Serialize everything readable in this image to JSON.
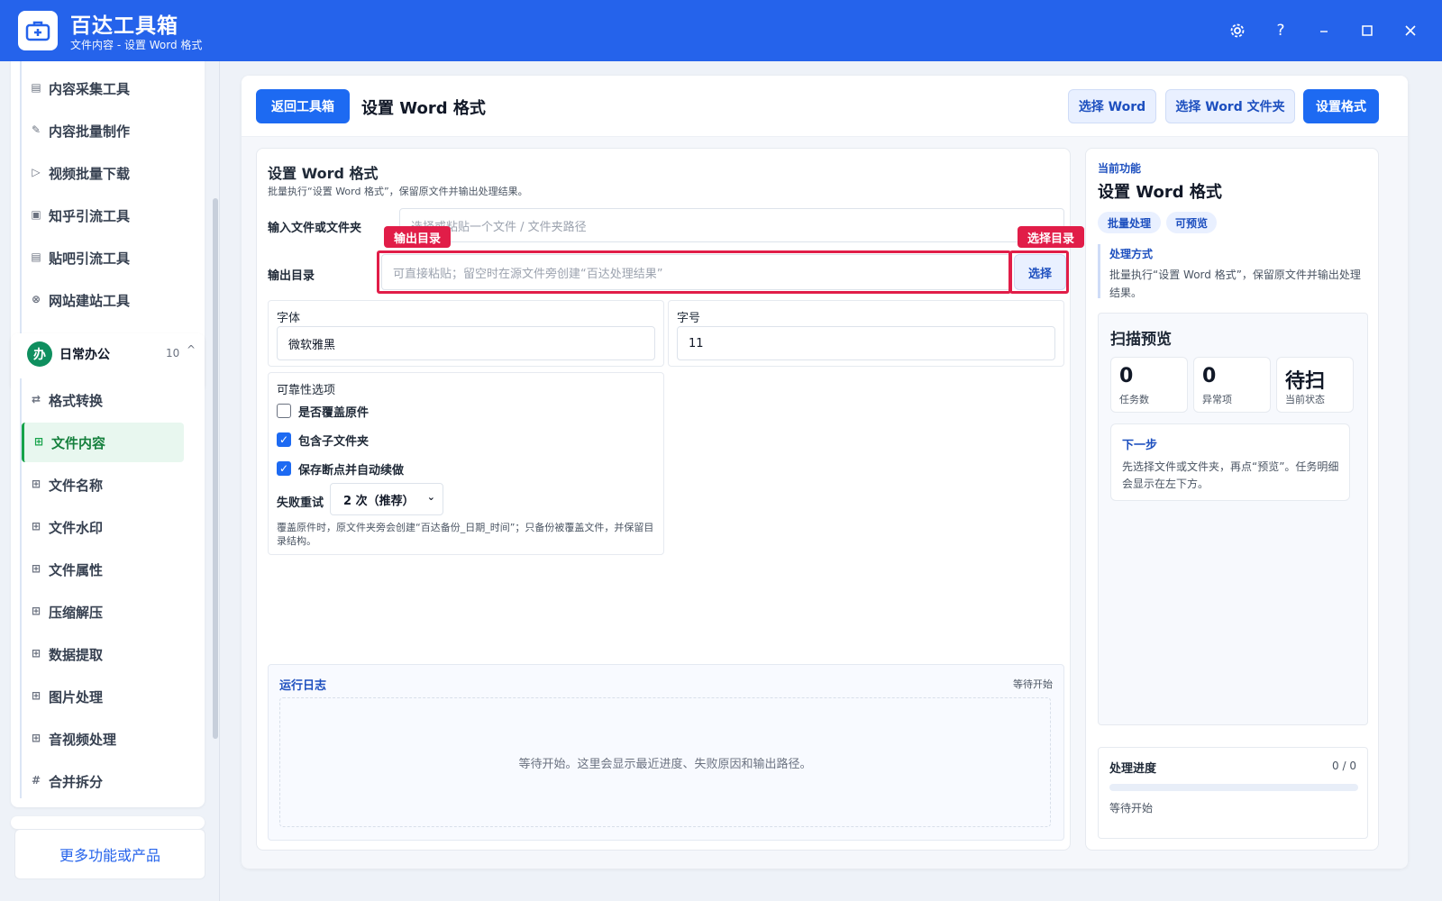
{
  "titlebar": {
    "app_title": "百达工具箱",
    "subtitle": "文件内容 - 设置 Word 格式",
    "icons": [
      "settings-icon",
      "help-icon",
      "minimize-icon",
      "maximize-icon",
      "close-icon"
    ]
  },
  "sidebar": {
    "group1_items": [
      {
        "label": "内容采集工具",
        "icon": "collect-icon"
      },
      {
        "label": "内容批量制作",
        "icon": "pen-icon"
      },
      {
        "label": "视频批量下载",
        "icon": "video-icon"
      },
      {
        "label": "知乎引流工具",
        "icon": "zhihu-icon"
      },
      {
        "label": "贴吧引流工具",
        "icon": "tieba-icon"
      },
      {
        "label": "网站建站工具",
        "icon": "web-icon"
      }
    ],
    "group2": {
      "badge": "办",
      "title": "日常办公",
      "count": "10",
      "chevron": "^",
      "items": [
        {
          "label": "格式转换",
          "icon": "swap-icon"
        },
        {
          "label": "文件内容",
          "icon": "grid-icon",
          "active": true
        },
        {
          "label": "文件名称",
          "icon": "grid-icon"
        },
        {
          "label": "文件水印",
          "icon": "grid-icon"
        },
        {
          "label": "文件属性",
          "icon": "grid-icon"
        },
        {
          "label": "压缩解压",
          "icon": "grid-icon"
        },
        {
          "label": "数据提取",
          "icon": "grid-icon"
        },
        {
          "label": "图片处理",
          "icon": "grid-icon"
        },
        {
          "label": "音视频处理",
          "icon": "grid-icon"
        },
        {
          "label": "合并拆分",
          "icon": "hash-icon"
        }
      ]
    },
    "more_label": "更多功能或产品"
  },
  "topbar": {
    "back_label": "返回工具箱",
    "title": "设置 Word 格式",
    "select_word_label": "选择 Word",
    "select_folder_label": "选择 Word 文件夹",
    "set_format_label": "设置格式"
  },
  "form": {
    "title": "设置 Word 格式",
    "desc": "批量执行“设置 Word 格式”，保留原文件并输出处理结果。",
    "input_label": "输入文件或文件夹",
    "input_placeholder": "选择或粘贴一个文件 / 文件夹路径",
    "output_label": "输出目录",
    "output_placeholder": "可直接粘贴；留空时在源文件旁创建“百达处理结果”",
    "choose_label": "选择",
    "tag_output": "输出目录",
    "tag_choose": "选择目录",
    "font_label": "字体",
    "font_value": "微软雅黑",
    "size_label": "字号",
    "size_value": "11",
    "reliability_title": "可靠性选项",
    "options": [
      {
        "label": "是否覆盖原件",
        "checked": false
      },
      {
        "label": "包含子文件夹",
        "checked": true
      },
      {
        "label": "保存断点并自动续做",
        "checked": true
      }
    ],
    "retry_label": "失败重试",
    "retry_value": "2 次（推荐）",
    "note": "覆盖原件时，原文件夹旁会创建“百达备份_日期_时间”；只备份被覆盖文件，并保留目录结构。"
  },
  "log": {
    "title": "运行日志",
    "status": "等待开始",
    "empty_text": "等待开始。这里会显示最近进度、失败原因和输出路径。"
  },
  "right_panel": {
    "current_label": "当前功能",
    "title": "设置 Word 格式",
    "chips": [
      "批量处理",
      "可预览"
    ],
    "method_title": "处理方式",
    "method_desc": "批量执行“设置 Word 格式”，保留原文件并输出处理结果。",
    "scan_title": "扫描预览",
    "stats": [
      {
        "value": "0",
        "label": "任务数"
      },
      {
        "value": "0",
        "label": "异常项"
      },
      {
        "value": "待扫",
        "label": "当前状态"
      }
    ],
    "next_title": "下一步",
    "next_desc": "先选择文件或文件夹，再点“预览”。任务明细会显示在左下方。",
    "progress_title": "处理进度",
    "progress_count": "0 / 0",
    "progress_value": 0,
    "progress_status": "等待开始"
  },
  "colors": {
    "accent": "#1d6af2",
    "titlebar": "#2563eb",
    "highlight": "#e11d48",
    "active_green": "#16a34a"
  }
}
